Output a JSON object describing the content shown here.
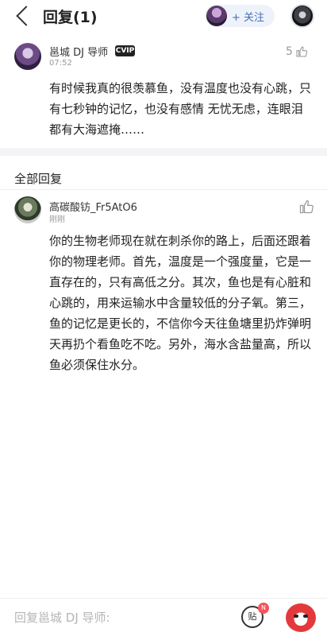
{
  "header": {
    "title": "回复(1)",
    "follow_label": "+ 关注"
  },
  "post": {
    "author": "邕城 DJ 导师",
    "badge": "CVIP",
    "time": "07:52",
    "like_count": "5",
    "text": "有时候我真的很羡慕鱼，没有温度也没有心跳，只有七秒钟的记忆，也没有感情 无忧无虑，连眼泪都有大海遮掩……"
  },
  "section": {
    "title": "全部回复"
  },
  "reply": {
    "author": "高碳酸钫_Fr5AtO6",
    "time": "刚刚",
    "text": "你的生物老师现在就在刺杀你的路上，后面还跟着你的物理老师。首先，温度是一个强度量，它是一直存在的，只有高低之分。其次，鱼也是有心脏和心跳的，用来运输水中含量较低的分子氧。第三，鱼的记忆是更长的，不信你今天往鱼塘里扔炸弹明天再扔个看鱼吃不吃。另外，海水含盐量高，所以鱼必须保住水分。"
  },
  "bottom_bar": {
    "reply_placeholder": "回复邕城 DJ 导师:",
    "sticker_label": "贴",
    "sticker_badge": "N"
  },
  "colors": {
    "accent": "#4a6fb5",
    "badge_red": "#f2545b",
    "divider": "#f4f4f6"
  }
}
